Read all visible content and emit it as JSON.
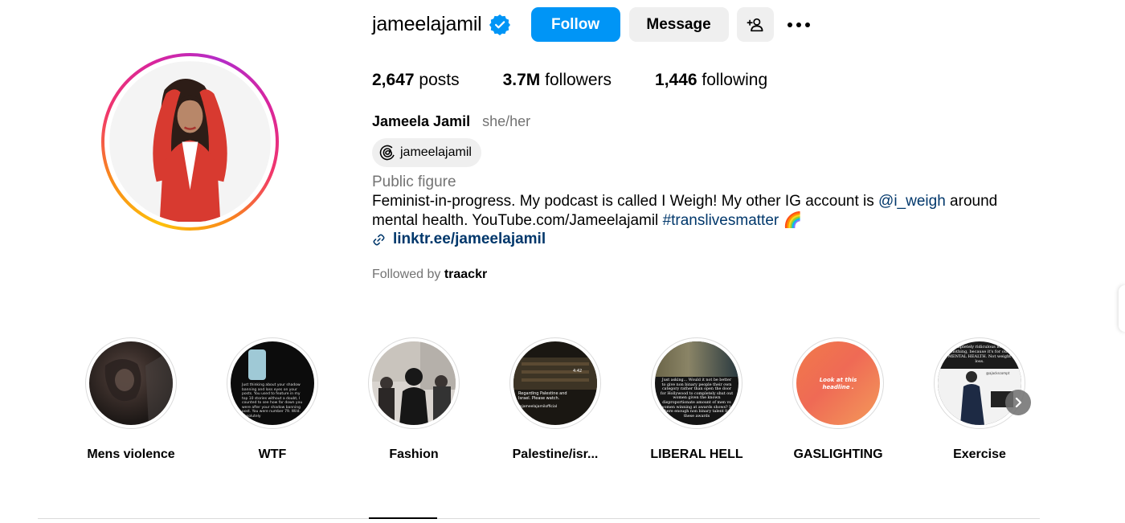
{
  "profile": {
    "username": "jameelajamil",
    "verified": true,
    "follow_label": "Follow",
    "message_label": "Message",
    "stats": {
      "posts_value": "2,647",
      "posts_label": "posts",
      "followers_value": "3.7M",
      "followers_label": "followers",
      "following_value": "1,446",
      "following_label": "following"
    },
    "full_name": "Jameela Jamil",
    "pronouns": "she/her",
    "threads_handle": "jameelajamil",
    "category": "Public figure",
    "bio": {
      "part1": "Feminist-in-progress. My podcast is called I Weigh! My other IG account is ",
      "mention": "@i_weigh",
      "part2": " around mental health. YouTube.com/Jameelajamil ",
      "hashtag": "#translivesmatter",
      "emoji": "🌈"
    },
    "link": "linktr.ee/jameelajamil",
    "followed_by_prefix": "Followed by",
    "followed_by_user": "traackr"
  },
  "highlights": [
    {
      "label": "Mens violence"
    },
    {
      "label": "WTF"
    },
    {
      "label": "Fashion"
    },
    {
      "label": "Palestine/isr..."
    },
    {
      "label": "LIBERAL HELL"
    },
    {
      "label": "GASLIGHTING"
    },
    {
      "label": "Exercise"
    }
  ],
  "highlight_texts": {
    "gaslighting_cover": "Look at this headline .",
    "palestine_cover": "Regarding Palestine and Israel. Please watch.",
    "palestine_handle": "@jameelajamilofficial",
    "palestine_time": "4:42",
    "liberal_cover": "Just asking... Would it not be better to give non binary people their own category rather than open the door for Hollywood to completely shut out women given the known disproportionate amount of men vs women winning at awards shows? Is there enough non binary talent for these awards",
    "wtf_cover": "Just thinking about your shadow banning and loss eyes on your posts. You used to feature in my top 10 stories without a doubt, I counted to see how far down you were after your shadow banning post. You were number 79. Wild. Absolutely",
    "exercise_cover": "completely ridiculous loose clothing, because it's for our MENTAL HEALTH. Not weight loss.",
    "exercise_handle": "@ajackscompt"
  },
  "colors": {
    "follow_blue": "#0095f6",
    "link_blue": "#00376b",
    "secondary_gray": "#737373",
    "button_gray": "#efefef"
  }
}
